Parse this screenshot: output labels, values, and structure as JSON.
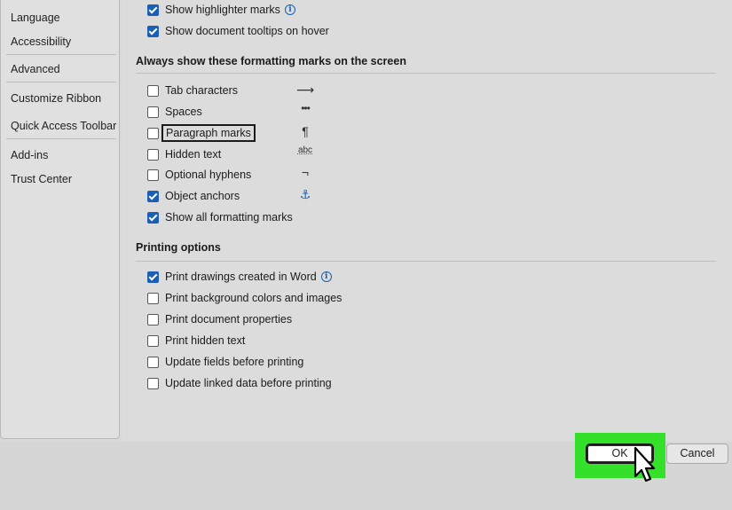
{
  "sidebar": {
    "items": [
      {
        "label": "Language"
      },
      {
        "label": "Accessibility"
      },
      {
        "label": "Advanced"
      },
      {
        "label": "Customize Ribbon"
      },
      {
        "label": "Quick Access Toolbar"
      },
      {
        "label": "Add-ins"
      },
      {
        "label": "Trust Center"
      }
    ]
  },
  "display_options": [
    {
      "label": "Show highlighter marks",
      "checked": true,
      "info": true
    },
    {
      "label": "Show document tooltips on hover",
      "checked": true
    }
  ],
  "formatting_marks": {
    "title": "Always show these formatting marks on the screen",
    "items": [
      {
        "label": "Tab characters",
        "checked": false,
        "mark": "⟶",
        "mark_icon": "arrow-right-icon"
      },
      {
        "label": "Spaces",
        "checked": false,
        "mark": "•••",
        "mark_icon": "dots-icon"
      },
      {
        "label": "Paragraph marks",
        "checked": false,
        "mark": "¶",
        "mark_icon": "pilcrow-icon"
      },
      {
        "label": "Hidden text",
        "checked": false,
        "mark": "abc",
        "mark_icon": "hidden-text-icon"
      },
      {
        "label": "Optional hyphens",
        "checked": false,
        "mark": "¬",
        "mark_icon": "not-sign-icon"
      },
      {
        "label": "Object anchors",
        "checked": true,
        "mark": "⚓",
        "mark_icon": "anchor-icon"
      },
      {
        "label": "Show all formatting marks",
        "checked": true
      }
    ]
  },
  "printing": {
    "title": "Printing options",
    "items": [
      {
        "label": "Print drawings created in Word",
        "checked": true,
        "info": true
      },
      {
        "label": "Print background colors and images",
        "checked": false
      },
      {
        "label": "Print document properties",
        "checked": false
      },
      {
        "label": "Print hidden text",
        "checked": false
      },
      {
        "label": "Update fields before printing",
        "checked": false
      },
      {
        "label": "Update linked data before printing",
        "checked": false
      }
    ]
  },
  "footer": {
    "ok_label": "OK",
    "cancel_label": "Cancel"
  },
  "colors": {
    "accent": "#1a5fb4",
    "highlight": "#35e02a"
  }
}
